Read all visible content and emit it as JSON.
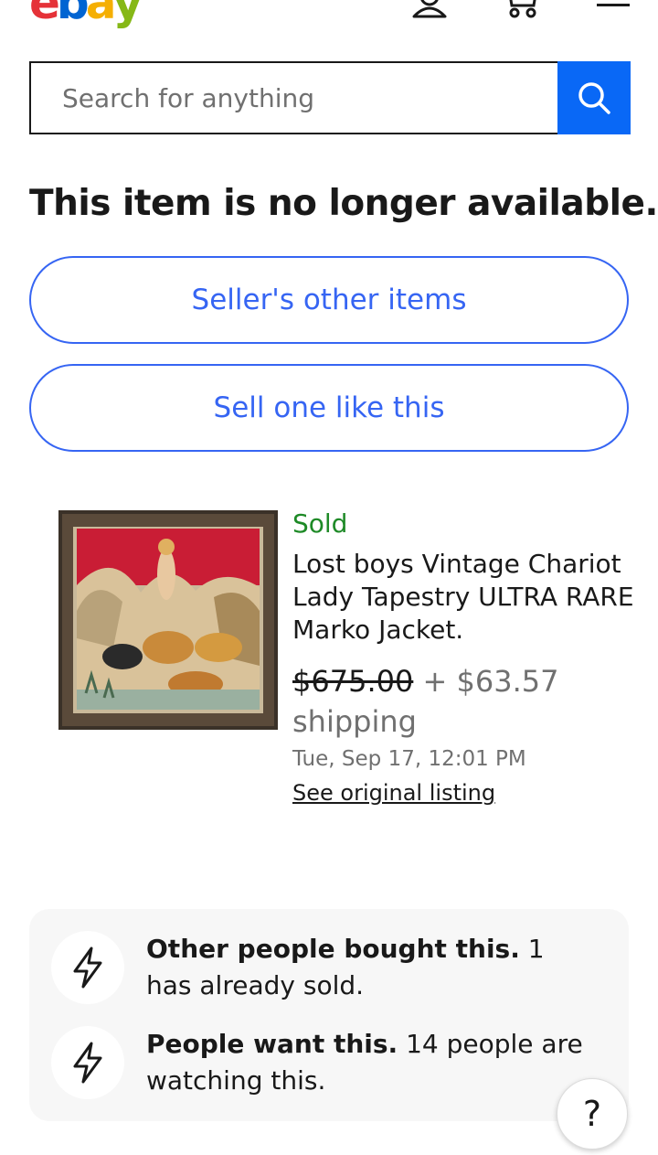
{
  "header": {
    "logo_letters": [
      {
        "ch": "e",
        "color": "#e53238"
      },
      {
        "ch": "b",
        "color": "#0064d2"
      },
      {
        "ch": "a",
        "color": "#f5af02"
      },
      {
        "ch": "y",
        "color": "#86b817"
      }
    ],
    "icons": [
      "profile-icon",
      "cart-icon",
      "menu-icon"
    ]
  },
  "search": {
    "placeholder": "Search for anything",
    "button_icon": "search-icon",
    "button_color": "#0968f6"
  },
  "headline": "This item is no longer available.",
  "buttons": {
    "sellers_other_items": "Seller's other items",
    "sell_one_like_this": "Sell one like this"
  },
  "item": {
    "status": "Sold",
    "title": "Lost boys Vintage Chariot Lady Tapestry ULTRA RARE Marko Jacket.",
    "price": "$675.00",
    "shipping": "+ $63.57 shipping",
    "date": "Tue, Sep 17, 12:01 PM",
    "link": "See original listing",
    "status_color": "#1e8a27"
  },
  "signals": [
    {
      "icon": "lightning-icon",
      "bold": "Other people bought this.",
      "text": " 1 has already sold."
    },
    {
      "icon": "lightning-icon",
      "bold": "People want this.",
      "text": " 14 people are watching this."
    }
  ],
  "help": {
    "label": "?"
  },
  "colors": {
    "accent": "#3665f3",
    "text": "#191919",
    "muted": "#707070"
  }
}
